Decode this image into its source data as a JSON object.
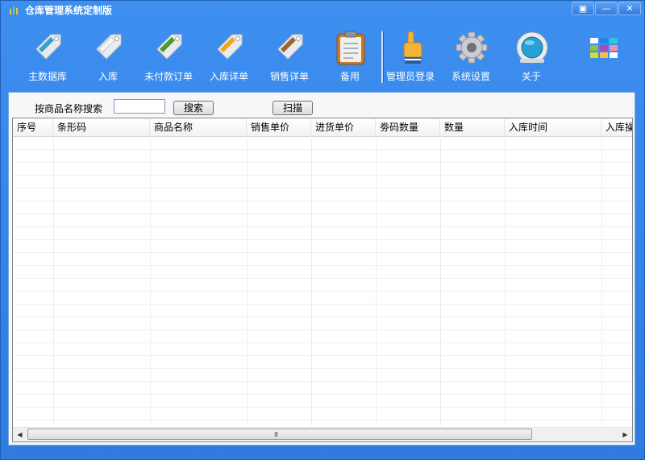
{
  "window": {
    "title": "仓库管理系统定制版",
    "controls": {
      "restore": "▣",
      "minimize": "—",
      "close": "✕"
    }
  },
  "toolbar": {
    "items": [
      {
        "label": "主数据库",
        "icon": "tag-blue-icon",
        "color": "#3aa0c8"
      },
      {
        "label": "入库",
        "icon": "tag-white-icon",
        "color": "#f2f2f2"
      },
      {
        "label": "未付款订单",
        "icon": "tag-green-icon",
        "color": "#4d9a2a"
      },
      {
        "label": "入库详单",
        "icon": "tag-orange-icon",
        "color": "#f2a51c"
      },
      {
        "label": "销售详单",
        "icon": "tag-brown-icon",
        "color": "#a0652c"
      },
      {
        "label": "备用",
        "icon": "clipboard-icon",
        "color": "#c97a2c"
      },
      {
        "label": "管理员登录",
        "icon": "pointing-hand-icon",
        "color": "#f4b43a"
      },
      {
        "label": "系统设置",
        "icon": "gear-icon",
        "color": "#c9ccd0"
      },
      {
        "label": "关于",
        "icon": "about-badge-icon",
        "color": "#2a9fd4"
      }
    ],
    "extra_icon": "color-grid-icon"
  },
  "search": {
    "label": "按商品名称搜索",
    "value": "",
    "button": "搜索",
    "scan_button": "扫描"
  },
  "table": {
    "columns": [
      "序号",
      "条形码",
      "商品名称",
      "销售单价",
      "进货单价",
      "劵码数量",
      "数量",
      "入库时间",
      "入库操"
    ],
    "rows": []
  },
  "scrollbar": {
    "grip": "III"
  }
}
